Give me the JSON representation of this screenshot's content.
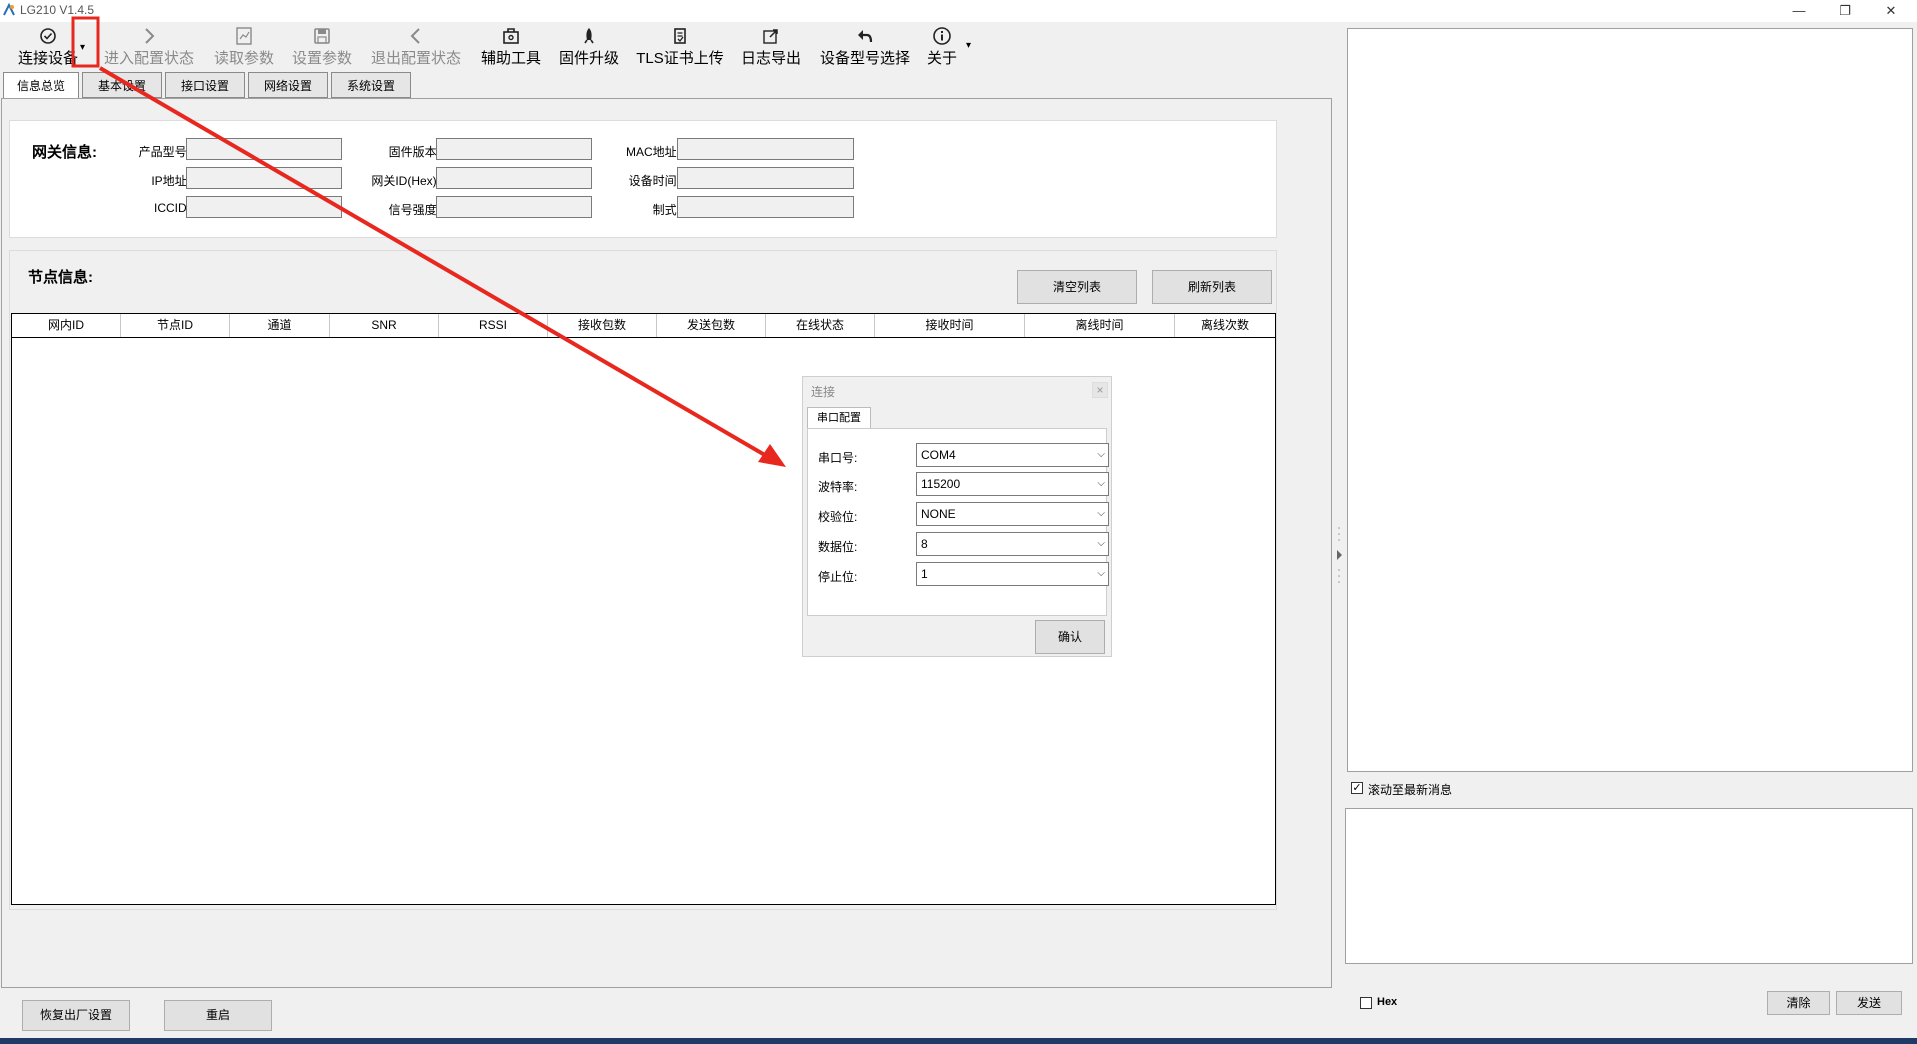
{
  "window": {
    "title": "LG210 V1.4.5",
    "minimize": "—",
    "restore": "❐",
    "close": "✕"
  },
  "toolbar": {
    "connect": "连接设备",
    "enter_config": "进入配置状态",
    "read_params": "读取参数",
    "set_params": "设置参数",
    "exit_config": "退出配置状态",
    "tools": "辅助工具",
    "firmware": "固件升级",
    "tls": "TLS证书上传",
    "log_export": "日志导出",
    "model_select": "设备型号选择",
    "about": "关于",
    "dropdown": "▾"
  },
  "tabs": [
    "信息总览",
    "基本设置",
    "接口设置",
    "网络设置",
    "系统设置"
  ],
  "gateway": {
    "title": "网关信息:",
    "col1": [
      "产品型号:",
      "IP地址:",
      "ICCID:"
    ],
    "col2": [
      "固件版本:",
      "网关ID(Hex):",
      "信号强度:"
    ],
    "col3": [
      "MAC地址:",
      "设备时间:",
      "制式:"
    ]
  },
  "nodes": {
    "title": "节点信息:",
    "clear_btn": "清空列表",
    "refresh_btn": "刷新列表",
    "columns": [
      "网内ID",
      "节点ID",
      "通道",
      "SNR",
      "RSSI",
      "接收包数",
      "发送包数",
      "在线状态",
      "接收时间",
      "离线时间",
      "离线次数"
    ]
  },
  "dialog": {
    "title": "连接",
    "close": "×",
    "tab": "串口配置",
    "port_label": "串口号:",
    "port_value": "COM4",
    "baud_label": "波特率:",
    "baud_value": "115200",
    "parity_label": "校验位:",
    "parity_value": "NONE",
    "databits_label": "数据位:",
    "databits_value": "8",
    "stopbits_label": "停止位:",
    "stopbits_value": "1",
    "ok_btn": "确认"
  },
  "right": {
    "scroll_latest": "滚动至最新消息",
    "hex": "Hex",
    "clear_btn": "清除",
    "send_btn": "发送"
  },
  "bottom": {
    "factory_reset": "恢复出厂设置",
    "reboot": "重启"
  },
  "colors": {
    "annotation_red": "#e8281e"
  }
}
